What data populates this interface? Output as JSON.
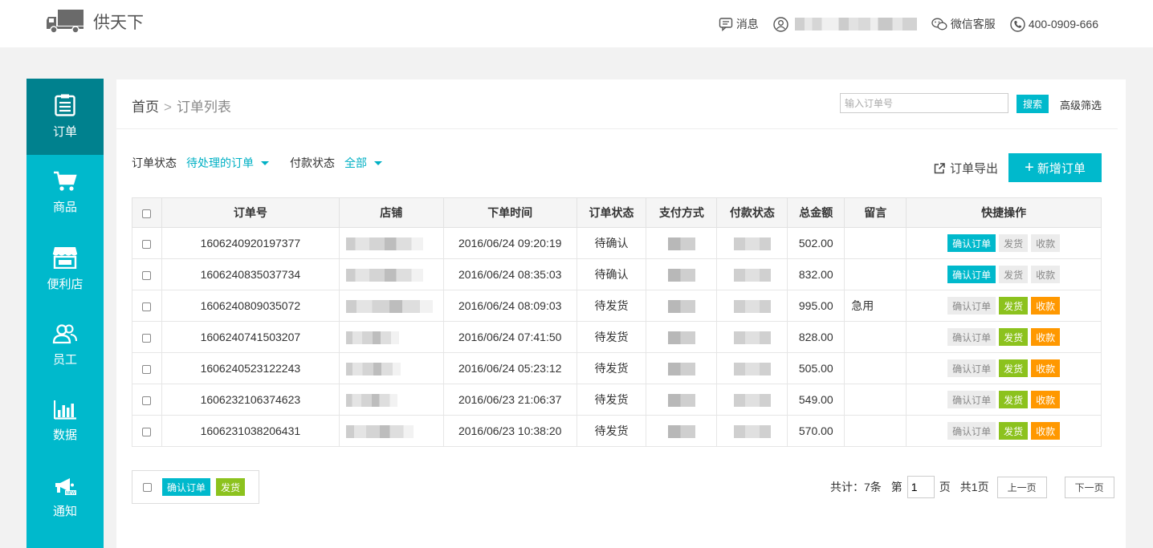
{
  "header": {
    "logo_text": "供天下",
    "messages_label": "消息",
    "wechat_label": "微信客服",
    "phone": "400-0909-666"
  },
  "sidebar": {
    "items": [
      {
        "label": "订单",
        "icon": "clipboard-icon",
        "active": true
      },
      {
        "label": "商品",
        "icon": "cart-icon",
        "active": false
      },
      {
        "label": "便利店",
        "icon": "store-icon",
        "active": false
      },
      {
        "label": "员工",
        "icon": "users-icon",
        "active": false
      },
      {
        "label": "数据",
        "icon": "bar-chart-icon",
        "active": false
      },
      {
        "label": "通知",
        "icon": "megaphone-icon",
        "active": false
      }
    ]
  },
  "breadcrumb": {
    "home": "首页",
    "separator": ">",
    "current": "订单列表"
  },
  "search": {
    "placeholder": "输入订单号",
    "button": "搜索",
    "advanced": "高级筛选"
  },
  "filters": {
    "order_status_label": "订单状态",
    "order_status_value": "待处理的订单",
    "payment_status_label": "付款状态",
    "payment_status_value": "全部"
  },
  "actions": {
    "export": "订单导出",
    "add_order": "新增订单"
  },
  "table": {
    "headers": [
      "订单号",
      "店铺",
      "下单时间",
      "订单状态",
      "支付方式",
      "付款状态",
      "总金额",
      "留言",
      "快捷操作"
    ],
    "op_labels": {
      "confirm": "确认订单",
      "ship": "发货",
      "collect": "收款"
    },
    "rows": [
      {
        "order_no": "1606240920197377",
        "time": "2016/06/24 09:20:19",
        "status": "待确认",
        "amount": "502.00",
        "note": ""
      },
      {
        "order_no": "1606240835037734",
        "time": "2016/06/24 08:35:03",
        "status": "待确认",
        "amount": "832.00",
        "note": ""
      },
      {
        "order_no": "1606240809035072",
        "time": "2016/06/24 08:09:03",
        "status": "待发货",
        "amount": "995.00",
        "note": "急用"
      },
      {
        "order_no": "1606240741503207",
        "time": "2016/06/24 07:41:50",
        "status": "待发货",
        "amount": "828.00",
        "note": ""
      },
      {
        "order_no": "1606240523122243",
        "time": "2016/06/24 05:23:12",
        "status": "待发货",
        "amount": "505.00",
        "note": ""
      },
      {
        "order_no": "1606232106374623",
        "time": "2016/06/23 21:06:37",
        "status": "待发货",
        "amount": "549.00",
        "note": ""
      },
      {
        "order_no": "1606231038206431",
        "time": "2016/06/23 10:38:20",
        "status": "待发货",
        "amount": "570.00",
        "note": ""
      }
    ]
  },
  "bulk": {
    "confirm": "确认订单",
    "ship": "发货"
  },
  "pager": {
    "total": "共计：7条",
    "page_prefix": "第",
    "page_value": "1",
    "page_suffix": "页",
    "page_count": "共1页",
    "prev": "上一页",
    "next": "下一页"
  },
  "colors": {
    "accent": "#00b9cc",
    "sidebar_active": "#00818e",
    "ship_green": "#8cc21e",
    "collect_orange": "#ff9800"
  }
}
